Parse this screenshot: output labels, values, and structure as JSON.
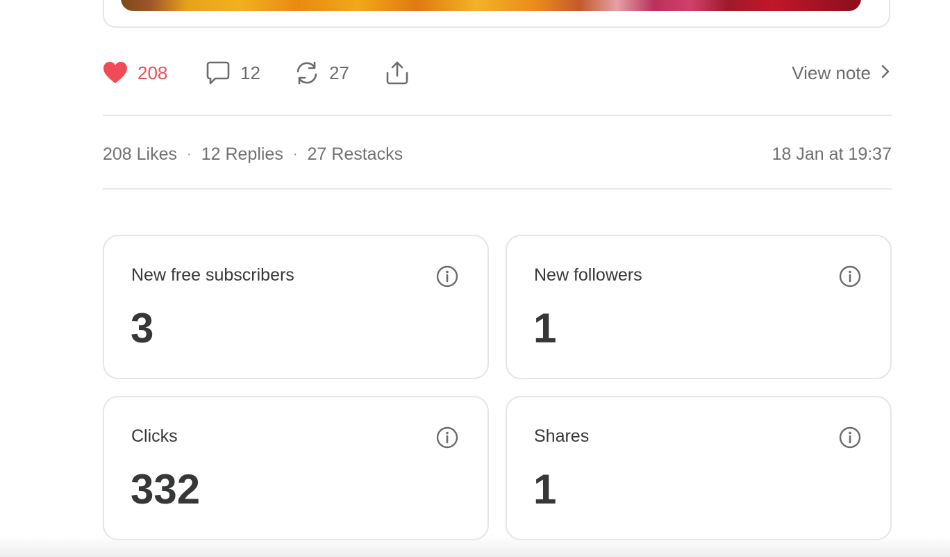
{
  "note": {
    "image_alt": "flowers",
    "likes": "208",
    "replies": "12",
    "restacks": "27",
    "view_note_label": "View note"
  },
  "summary": {
    "likes_text": "208 Likes",
    "replies_text": "12 Replies",
    "restacks_text": "27 Restacks",
    "separator": "·",
    "timestamp": "18 Jan at 19:37"
  },
  "metrics": [
    {
      "label": "New free subscribers",
      "value": "3"
    },
    {
      "label": "New followers",
      "value": "1"
    },
    {
      "label": "Clicks",
      "value": "332"
    },
    {
      "label": "Shares",
      "value": "1"
    }
  ],
  "colors": {
    "like_accent": "#ef4c56",
    "text_primary": "#363737",
    "text_secondary": "#717171",
    "border": "#e5e5e5"
  },
  "icons": {
    "like": "heart-icon",
    "reply": "comment-icon",
    "restack": "restack-icon",
    "share": "share-icon",
    "view_note": "chevron-right-icon",
    "info": "info-icon"
  }
}
